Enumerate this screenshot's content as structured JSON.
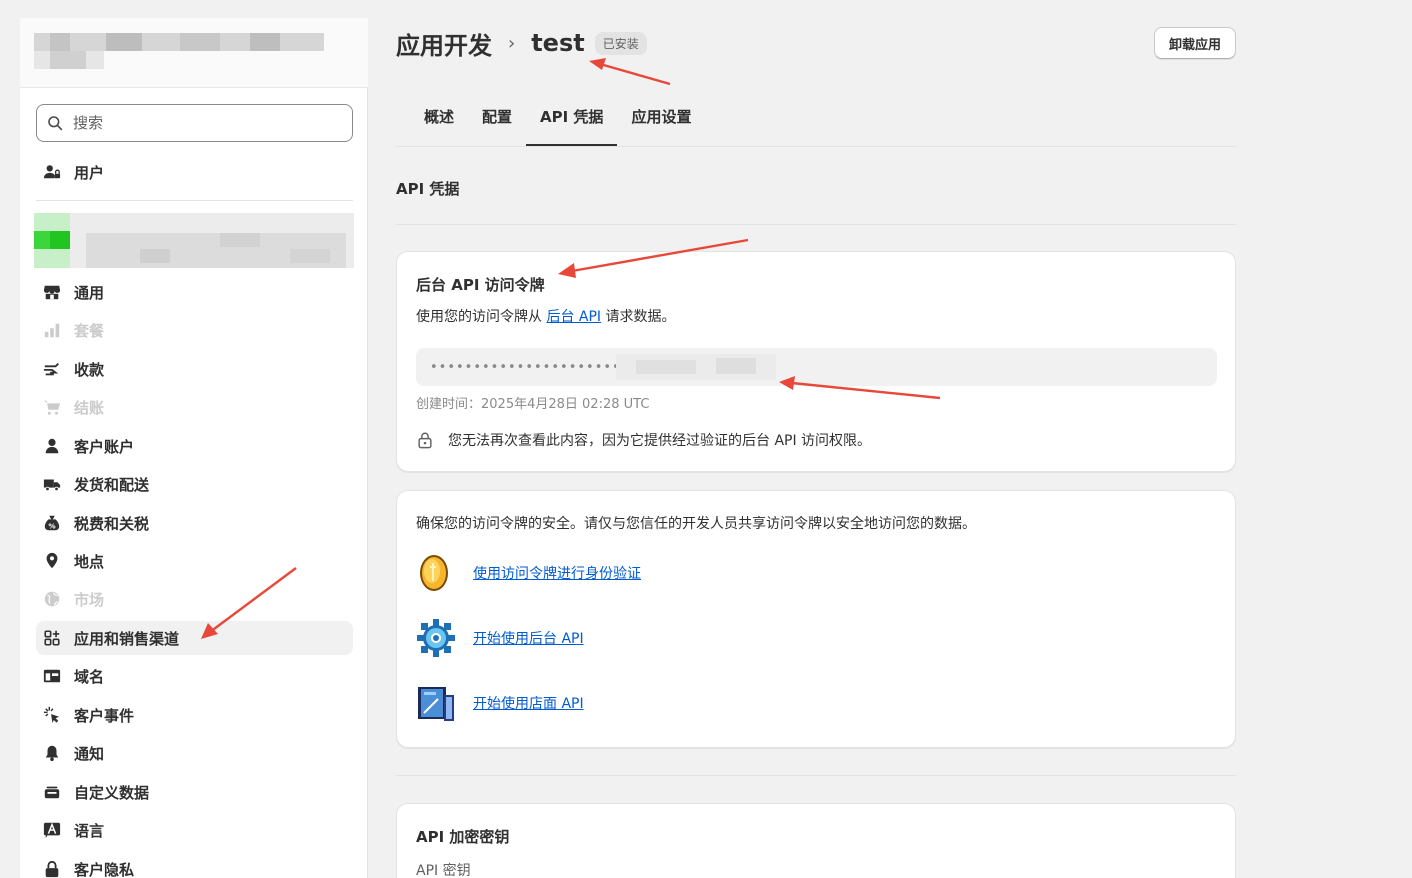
{
  "sidebar": {
    "search": {
      "placeholder": "搜索"
    },
    "items": [
      {
        "label": "用户",
        "icon": "user-lock-icon"
      },
      {
        "label": "通用",
        "icon": "store-icon"
      },
      {
        "label": "套餐",
        "icon": "chart-bar-icon",
        "disabled": true
      },
      {
        "label": "收款",
        "icon": "payment-hand-icon"
      },
      {
        "label": "结账",
        "icon": "cart-icon",
        "disabled": true
      },
      {
        "label": "客户账户",
        "icon": "person-icon"
      },
      {
        "label": "发货和配送",
        "icon": "truck-icon"
      },
      {
        "label": "税费和关税",
        "icon": "tax-bag-icon"
      },
      {
        "label": "地点",
        "icon": "location-pin-icon"
      },
      {
        "label": "市场",
        "icon": "globe-icon",
        "disabled": true
      },
      {
        "label": "应用和销售渠道",
        "icon": "apps-grid-icon",
        "active": true
      },
      {
        "label": "域名",
        "icon": "domain-icon"
      },
      {
        "label": "客户事件",
        "icon": "cursor-click-icon"
      },
      {
        "label": "通知",
        "icon": "bell-icon"
      },
      {
        "label": "自定义数据",
        "icon": "database-icon"
      },
      {
        "label": "语言",
        "icon": "translate-icon"
      },
      {
        "label": "客户隐私",
        "icon": "lock-icon"
      }
    ]
  },
  "header": {
    "breadcrumb_parent": "应用开发",
    "app_name": "test",
    "badge": "已安装",
    "uninstall_label": "卸载应用"
  },
  "tabs": [
    {
      "label": "概述"
    },
    {
      "label": "配置"
    },
    {
      "label": "API 凭据",
      "active": true
    },
    {
      "label": "应用设置"
    }
  ],
  "section_title": "API 凭据",
  "admin_token_card": {
    "title": "后台 API 访问令牌",
    "desc_prefix": "使用您的访问令牌从 ",
    "desc_link": "后台 API",
    "desc_suffix": " 请求数据。",
    "token_masked": "••••••••••••••••••••••••",
    "created": "创建时间：2025年4月28日 02:28 UTC",
    "warning": "您无法再次查看此内容，因为它提供经过验证的后台 API 访问权限。"
  },
  "security_card": {
    "text": "确保您的访问令牌的安全。请仅与您信任的开发人员共享访问令牌以安全地访问您的数据。",
    "links": [
      {
        "label": "使用访问令牌进行身份验证",
        "icon": "gold-coin-icon"
      },
      {
        "label": "开始使用后台 API",
        "icon": "gear-icon"
      },
      {
        "label": "开始使用店面 API",
        "icon": "blueprint-icon"
      }
    ]
  },
  "secret_card": {
    "title": "API 加密密钥",
    "subtitle": "API 密钥"
  },
  "colors": {
    "link": "#005bd3",
    "background": "#f1f1f1",
    "annotation_arrow": "#e8483a"
  }
}
